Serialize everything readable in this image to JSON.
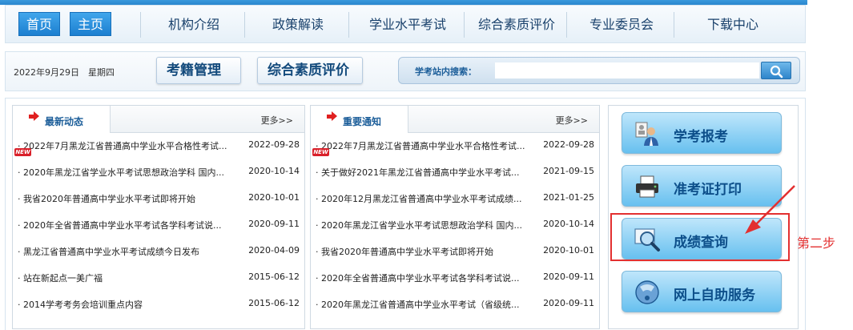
{
  "nav": {
    "home_buttons": [
      "首页",
      "主页"
    ],
    "items": [
      "机构介绍",
      "政策解读",
      "学业水平考试",
      "综合素质评价",
      "专业委员会",
      "下载中心"
    ]
  },
  "toolbar": {
    "date": "2022年9月29日　星期四",
    "buttons": [
      "考籍管理",
      "综合素质评价"
    ],
    "search_label": "学考站内搜索：",
    "search_value": ""
  },
  "latest": {
    "title": "最新动态",
    "more": "更多>>",
    "items": [
      {
        "title": "· 2022年7月黑龙江省普通高中学业水平合格性考试...",
        "date": "2022-09-28",
        "new": true
      },
      {
        "title": "· 2020年黑龙江省学业水平考试思想政治学科  国内...",
        "date": "2020-10-14",
        "new": false
      },
      {
        "title": "· 我省2020年普通高中学业水平考试即将开始",
        "date": "2020-10-01",
        "new": false
      },
      {
        "title": "· 2020年全省普通高中学业水平考试各学科考试说...",
        "date": "2020-09-11",
        "new": false
      },
      {
        "title": "· 黑龙江省普通高中学业水平考试成绩今日发布",
        "date": "2020-04-09",
        "new": false
      },
      {
        "title": "· 站在新起点一美广福",
        "date": "2015-06-12",
        "new": false
      },
      {
        "title": "· 2014学考考务会培训重点内容",
        "date": "2015-06-12",
        "new": false
      }
    ]
  },
  "notices": {
    "title": "重要通知",
    "more": "更多>>",
    "items": [
      {
        "title": "· 2022年7月黑龙江省普通高中学业水平合格性考试...",
        "date": "2022-09-28",
        "new": true
      },
      {
        "title": "· 关于做好2021年黑龙江省普通高中学业水平考试...",
        "date": "2021-09-15",
        "new": false
      },
      {
        "title": "· 2020年12月黑龙江省普通高中学业水平考试成绩...",
        "date": "2021-01-25",
        "new": false
      },
      {
        "title": "· 2020年黑龙江省学业水平考试思想政治学科  国内...",
        "date": "2020-10-14",
        "new": false
      },
      {
        "title": "· 我省2020年普通高中学业水平考试即将开始",
        "date": "2020-10-01",
        "new": false
      },
      {
        "title": "· 2020年全省普通高中学业水平考试各学科考试说...",
        "date": "2020-09-11",
        "new": false
      },
      {
        "title": "· 2020年黑龙江省普通高中学业水平考试（省级统...",
        "date": "2020-09-11",
        "new": false
      }
    ]
  },
  "services": [
    {
      "label": "学考报考",
      "icon": "registration-icon"
    },
    {
      "label": "准考证打印",
      "icon": "printer-icon"
    },
    {
      "label": "成绩查询",
      "icon": "magnifier-icon"
    },
    {
      "label": "网上自助服务",
      "icon": "help-icon"
    }
  ],
  "annotation": {
    "step": "第二步",
    "color": "#e33030"
  },
  "new_badge": "NEW"
}
